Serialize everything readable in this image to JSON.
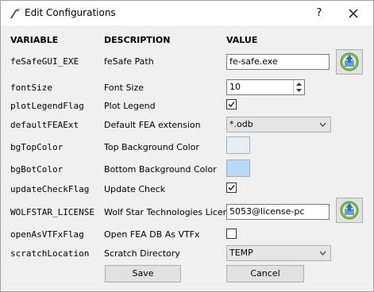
{
  "window": {
    "title": "Edit Configurations",
    "help_label": "?"
  },
  "headers": {
    "variable": "VARIABLE",
    "description": "DESCRIPTION",
    "value": "VALUE"
  },
  "rows": [
    {
      "variable": "feSafeGUI_EXE",
      "description": "feSafe Path",
      "value": "fe-safe.exe",
      "control": "text-with-browse"
    },
    {
      "variable": "fontSize",
      "description": "Font Size",
      "value": "10",
      "control": "spinbox"
    },
    {
      "variable": "plotLegendFlag",
      "description": "Plot Legend",
      "value": true,
      "control": "checkbox"
    },
    {
      "variable": "defaultFEAExt",
      "description": "Default FEA extension",
      "value": "*.odb",
      "control": "combobox"
    },
    {
      "variable": "bgTopColor",
      "description": "Top Background Color",
      "value": "#e6eef8",
      "control": "color"
    },
    {
      "variable": "bgBotColor",
      "description": "Bottom Background Color",
      "value": "#b6dbf6",
      "control": "color"
    },
    {
      "variable": "updateCheckFlag",
      "description": "Update Check",
      "value": true,
      "control": "checkbox"
    },
    {
      "variable": "WOLFSTAR_LICENSE",
      "description": "Wolf Star Technologies License",
      "value": "5053@license-pc",
      "control": "text-with-browse"
    },
    {
      "variable": "openAsVTFxFlag",
      "description": "Open FEA DB As VTFx",
      "value": false,
      "control": "checkbox"
    },
    {
      "variable": "scratchLocation",
      "description": "Scratch Directory",
      "value": "TEMP",
      "control": "combobox"
    }
  ],
  "buttons": {
    "save": "Save",
    "cancel": "Cancel"
  },
  "icons": {
    "window": "wolfstar-logo-icon",
    "browse": "folder-upload-icon",
    "close": "close-icon"
  }
}
